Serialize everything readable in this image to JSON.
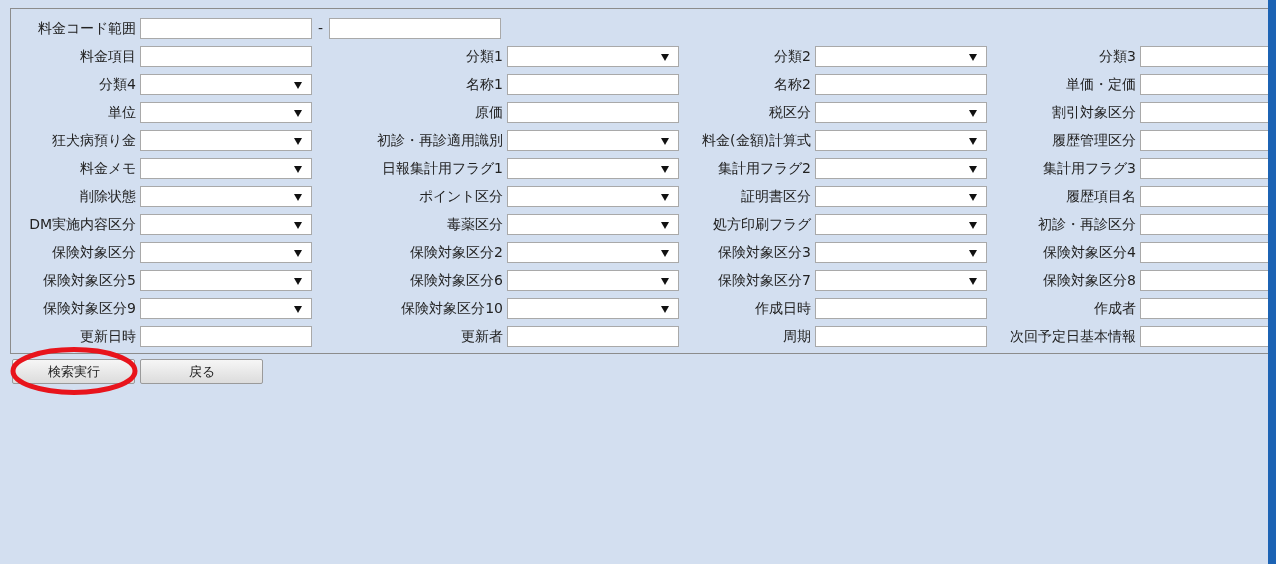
{
  "range": {
    "label": "料金コード範囲",
    "separator": "-"
  },
  "rows": [
    [
      {
        "label": "料金項目",
        "kind": "text"
      },
      {
        "label": "分類1",
        "kind": "select"
      },
      {
        "label": "分類2",
        "kind": "select"
      },
      {
        "label": "分類3",
        "kind": "text"
      }
    ],
    [
      {
        "label": "分類4",
        "kind": "select"
      },
      {
        "label": "名称1",
        "kind": "text"
      },
      {
        "label": "名称2",
        "kind": "text"
      },
      {
        "label": "単価・定価",
        "kind": "text"
      }
    ],
    [
      {
        "label": "単位",
        "kind": "select"
      },
      {
        "label": "原価",
        "kind": "text"
      },
      {
        "label": "税区分",
        "kind": "select"
      },
      {
        "label": "割引対象区分",
        "kind": "text"
      }
    ],
    [
      {
        "label": "狂犬病預り金",
        "kind": "select"
      },
      {
        "label": "初診・再診適用識別",
        "kind": "select"
      },
      {
        "label": "料金(金額)計算式",
        "kind": "select"
      },
      {
        "label": "履歴管理区分",
        "kind": "text"
      }
    ],
    [
      {
        "label": "料金メモ",
        "kind": "select"
      },
      {
        "label": "日報集計用フラグ1",
        "kind": "select"
      },
      {
        "label": "集計用フラグ2",
        "kind": "select"
      },
      {
        "label": "集計用フラグ3",
        "kind": "text"
      }
    ],
    [
      {
        "label": "削除状態",
        "kind": "select"
      },
      {
        "label": "ポイント区分",
        "kind": "select"
      },
      {
        "label": "証明書区分",
        "kind": "select"
      },
      {
        "label": "履歴項目名",
        "kind": "text"
      }
    ],
    [
      {
        "label": "DM実施内容区分",
        "kind": "select"
      },
      {
        "label": "毒薬区分",
        "kind": "select"
      },
      {
        "label": "処方印刷フラグ",
        "kind": "select"
      },
      {
        "label": "初診・再診区分",
        "kind": "text"
      }
    ],
    [
      {
        "label": "保険対象区分",
        "kind": "select"
      },
      {
        "label": "保険対象区分2",
        "kind": "select"
      },
      {
        "label": "保険対象区分3",
        "kind": "select"
      },
      {
        "label": "保険対象区分4",
        "kind": "text"
      }
    ],
    [
      {
        "label": "保険対象区分5",
        "kind": "select"
      },
      {
        "label": "保険対象区分6",
        "kind": "select"
      },
      {
        "label": "保険対象区分7",
        "kind": "select"
      },
      {
        "label": "保険対象区分8",
        "kind": "text"
      }
    ],
    [
      {
        "label": "保険対象区分9",
        "kind": "select"
      },
      {
        "label": "保険対象区分10",
        "kind": "select"
      },
      {
        "label": "作成日時",
        "kind": "text"
      },
      {
        "label": "作成者",
        "kind": "text"
      }
    ],
    [
      {
        "label": "更新日時",
        "kind": "text"
      },
      {
        "label": "更新者",
        "kind": "text"
      },
      {
        "label": "周期",
        "kind": "text"
      },
      {
        "label": "次回予定日基本情報",
        "kind": "text"
      }
    ]
  ],
  "buttons": [
    {
      "label": "検索実行",
      "highlighted": true
    },
    {
      "label": "戻る",
      "highlighted": false
    }
  ]
}
